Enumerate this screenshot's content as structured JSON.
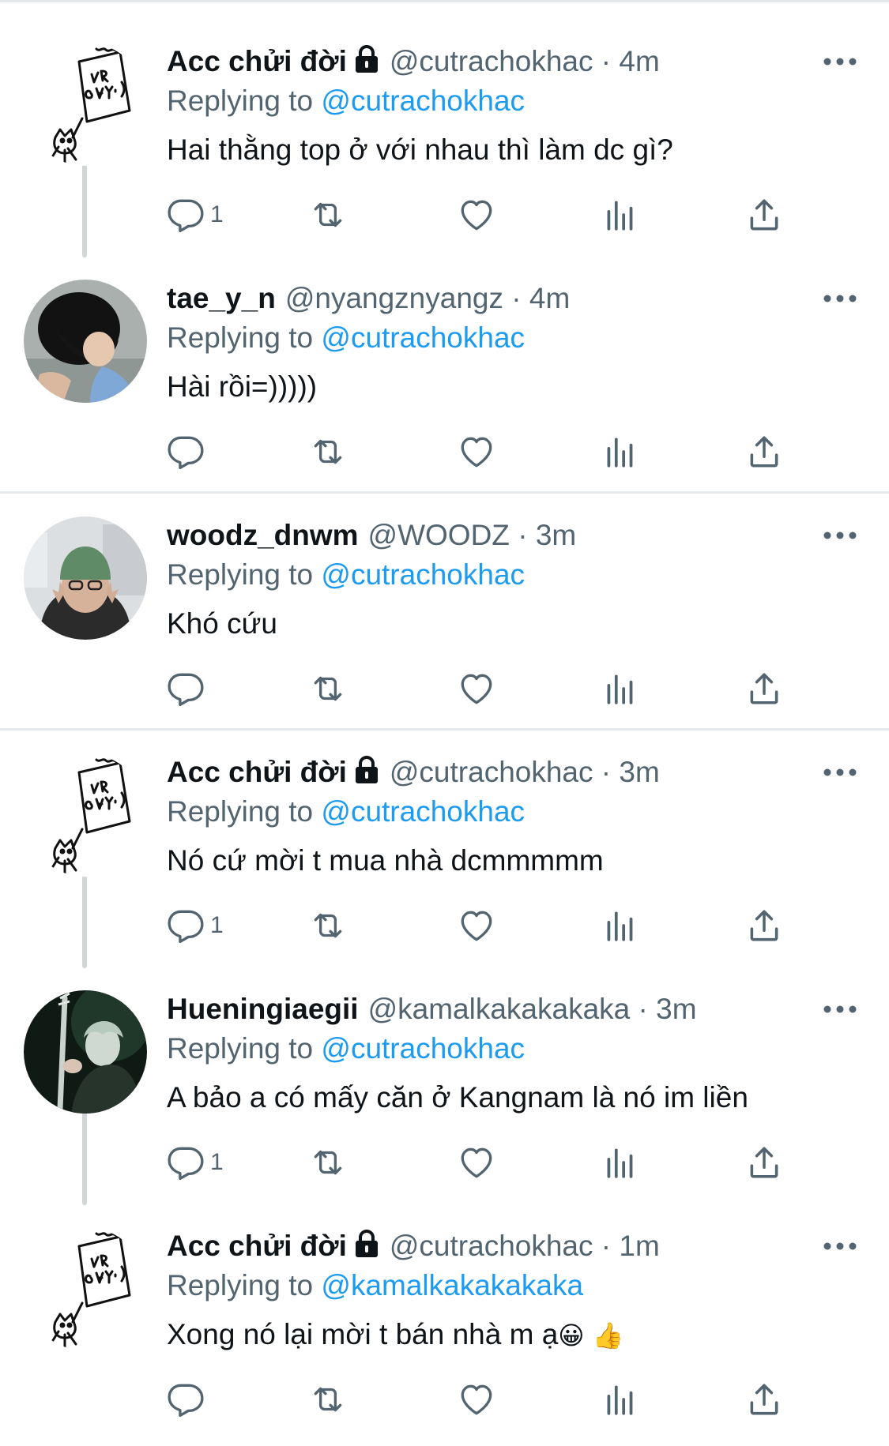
{
  "tweets": [
    {
      "display_name": "Acc chửi đời",
      "locked": true,
      "handle": "@cutrachokhac",
      "separator": "·",
      "time": "4m",
      "replying_label": "Replying to",
      "replying_to": "@cutrachokhac",
      "text": "Hai thằng top ở với nhau thì làm dc gì?",
      "reply_count": "1",
      "avatar": "ur-gay-cat-sketch"
    },
    {
      "display_name": "tae_y_n",
      "locked": false,
      "handle": "@nyangznyangz",
      "separator": "·",
      "time": "4m",
      "replying_label": "Replying to",
      "replying_to": "@cutrachokhac",
      "text": "Hài rồi=)))))",
      "reply_count": "",
      "avatar": "dark-haired-person-photo"
    },
    {
      "display_name": "woodz_dnwm",
      "locked": false,
      "handle": "@WOODZ",
      "separator": "·",
      "time": "3m",
      "replying_label": "Replying to",
      "replying_to": "@cutrachokhac",
      "text": "Khó cứu",
      "reply_count": "",
      "avatar": "person-green-beanie-photo"
    },
    {
      "display_name": "Acc chửi đời",
      "locked": true,
      "handle": "@cutrachokhac",
      "separator": "·",
      "time": "3m",
      "replying_label": "Replying to",
      "replying_to": "@cutrachokhac",
      "text": "Nó cứ mời t mua nhà dcmmmmm",
      "reply_count": "1",
      "avatar": "ur-gay-cat-sketch"
    },
    {
      "display_name": "Hueningiaegii",
      "locked": false,
      "handle": "@kamalkakakakaka",
      "separator": "·",
      "time": "3m",
      "replying_label": "Replying to",
      "replying_to": "@cutrachokhac",
      "text": "A bảo a có mấy căn ở Kangnam là nó im liền",
      "reply_count": "1",
      "avatar": "guitarist-stage-photo"
    },
    {
      "display_name": "Acc chửi đời",
      "locked": true,
      "handle": "@cutrachokhac",
      "separator": "·",
      "time": "1m",
      "replying_label": "Replying to",
      "replying_to": "@kamalkakakakaka",
      "text": "Xong nó lại mời t bán nhà m ạ",
      "emoji": "😀 👍",
      "reply_count": "",
      "avatar": "ur-gay-cat-sketch"
    }
  ],
  "colors": {
    "text": "#0f1419",
    "secondary": "#536471",
    "mention": "#1d9bf0",
    "divider": "#e6e9ec",
    "thread_line": "#d0d6da"
  },
  "icons": [
    "comment-icon",
    "retweet-icon",
    "like-icon",
    "views-icon",
    "share-icon",
    "more-icon",
    "lock-icon"
  ]
}
